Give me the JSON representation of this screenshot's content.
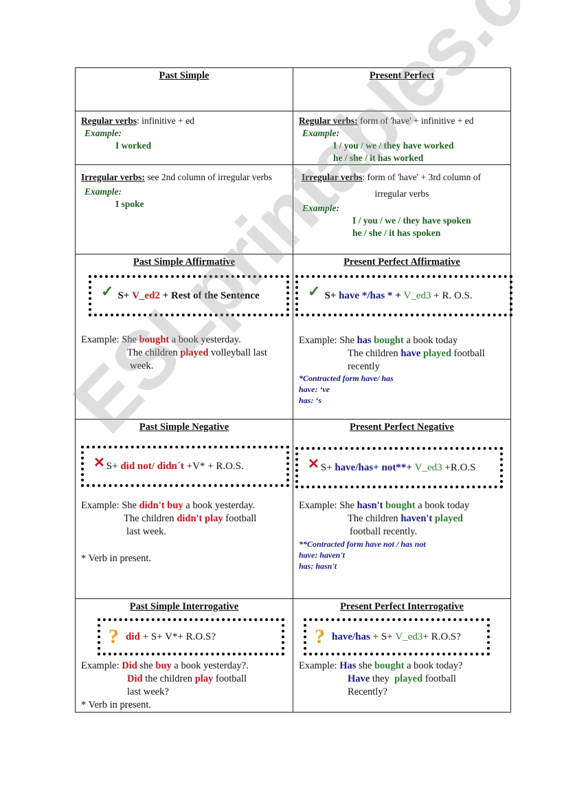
{
  "headers": {
    "past_simple": "Past Simple",
    "present_perfect": "Present Perfect"
  },
  "regular": {
    "ps_label": "Regular verbs",
    "ps_rule": ": infinitive + ed",
    "ps_example_label": "Example:",
    "ps_example": "I worked",
    "pp_label": "Regular verbs:",
    "pp_rule": " form of 'have' + infinitive + ed",
    "pp_example_label": "Example:",
    "pp_example_1": "I / you / we / they have worked",
    "pp_example_2": "he / she / it has worked"
  },
  "irregular": {
    "ps_label": "Irregular verbs:",
    "ps_rule": " see 2nd column of irregular verbs",
    "ps_example_label": "Example:",
    "ps_example": "I spoke",
    "pp_label": "Irregular verbs",
    "pp_rule_1": ": form of 'have' + 3rd column of",
    "pp_rule_2": "irregular verbs",
    "pp_example_label": "Example:",
    "pp_example_1": "I / you / we / they have spoken",
    "pp_example_2": "he / she / it has spoken"
  },
  "affirmative": {
    "ps_title": "Past Simple Affirmative",
    "ps_formula": {
      "s": "S+ ",
      "verb": "V_ed2",
      "rest": " + Rest of the Sentence"
    },
    "ps_example_label": "Example:",
    "ps_ex1": {
      "a": "She ",
      "b": "bought",
      "c": " a book yesterday."
    },
    "ps_ex2": {
      "a": "The children ",
      "b": "played",
      "c": " volleyball last"
    },
    "ps_ex3": "week.",
    "pp_title": "Present Perfect Affirmative",
    "pp_formula": {
      "s": "S+ ",
      "aux": "have */has *",
      "plus": " + ",
      "verb": "V_ed3",
      "rest": " + R. O.S."
    },
    "pp_example_label": "Example:",
    "pp_ex1": {
      "a": "She ",
      "aux": "has",
      "verb": "bought",
      "c": " a book today"
    },
    "pp_ex2": {
      "a": "The children ",
      "aux": "have",
      "verb": "played",
      "c": " football"
    },
    "pp_ex3": "recently",
    "pp_note_1": "*Contracted form have/ has",
    "pp_note_2": "have: ‘ve",
    "pp_note_3": "has: ‘s"
  },
  "negative": {
    "ps_title": "Past Simple Negative",
    "ps_formula": {
      "s": "S+ ",
      "aux": "did not/ didn´t",
      "rest": " +V* + R.O.S."
    },
    "ps_example_label": "Example:",
    "ps_ex1": {
      "a": "She ",
      "b": "didn't buy",
      "c": " a book yesterday."
    },
    "ps_ex2": {
      "a": "The children ",
      "b": "didn't play",
      "c": " football"
    },
    "ps_ex3": "last week.",
    "ps_note": "* Verb in present.",
    "pp_title": "Present Perfect Negative",
    "pp_formula": {
      "s": "S+ ",
      "aux": "have/has+ not**",
      "plus": "+ ",
      "verb": "V_ed3",
      "rest": " +R.O.S"
    },
    "pp_example_label": "Example:",
    "pp_ex1": {
      "a": "She ",
      "aux": "hasn't",
      "verb": "bought",
      "c": " a book today"
    },
    "pp_ex2": {
      "a": "The children ",
      "aux": "haven't",
      "verb": "played"
    },
    "pp_ex3": "football recently.",
    "pp_note_1": "**Contracted form have not / has not",
    "pp_note_2": "have: haven't",
    "pp_note_3": "has: hasn't"
  },
  "interrogative": {
    "ps_title": "Past Simple Interrogative",
    "ps_formula": {
      "aux": "did",
      "rest": " + S+ V*+ R.O.S?"
    },
    "ps_example_label": "Example:",
    "ps_ex1": {
      "aux": "Did",
      "a": " she ",
      "b": "buy",
      "c": " a book yesterday?."
    },
    "ps_ex2": {
      "aux": "Did",
      "a": " the children ",
      "b": "play",
      "c": " football"
    },
    "ps_ex3": "last week?",
    "ps_note": "* Verb in present.",
    "pp_title": "Present Perfect Interrogative",
    "pp_formula": {
      "aux": "have/has",
      "mid": " + S+ ",
      "verb": "V_ed3",
      "rest": "+ R.O.S?"
    },
    "pp_example_label": "Example:",
    "pp_ex1": {
      "aux": "Has",
      "a": " she ",
      "verb": "bought",
      "c": " a book today?"
    },
    "pp_ex2": {
      "aux": "Have",
      "a": " they  ",
      "verb": "played",
      "c": " football"
    },
    "pp_ex3": "Recently?"
  },
  "icons": {
    "check": "✓",
    "cross": "✕",
    "question": "?"
  },
  "watermark": "ESLprintables.com",
  "colors": {
    "red": "#c3161c",
    "blue": "#1a1a8c",
    "green": "#2e7d32",
    "orange": "#f0a020"
  }
}
